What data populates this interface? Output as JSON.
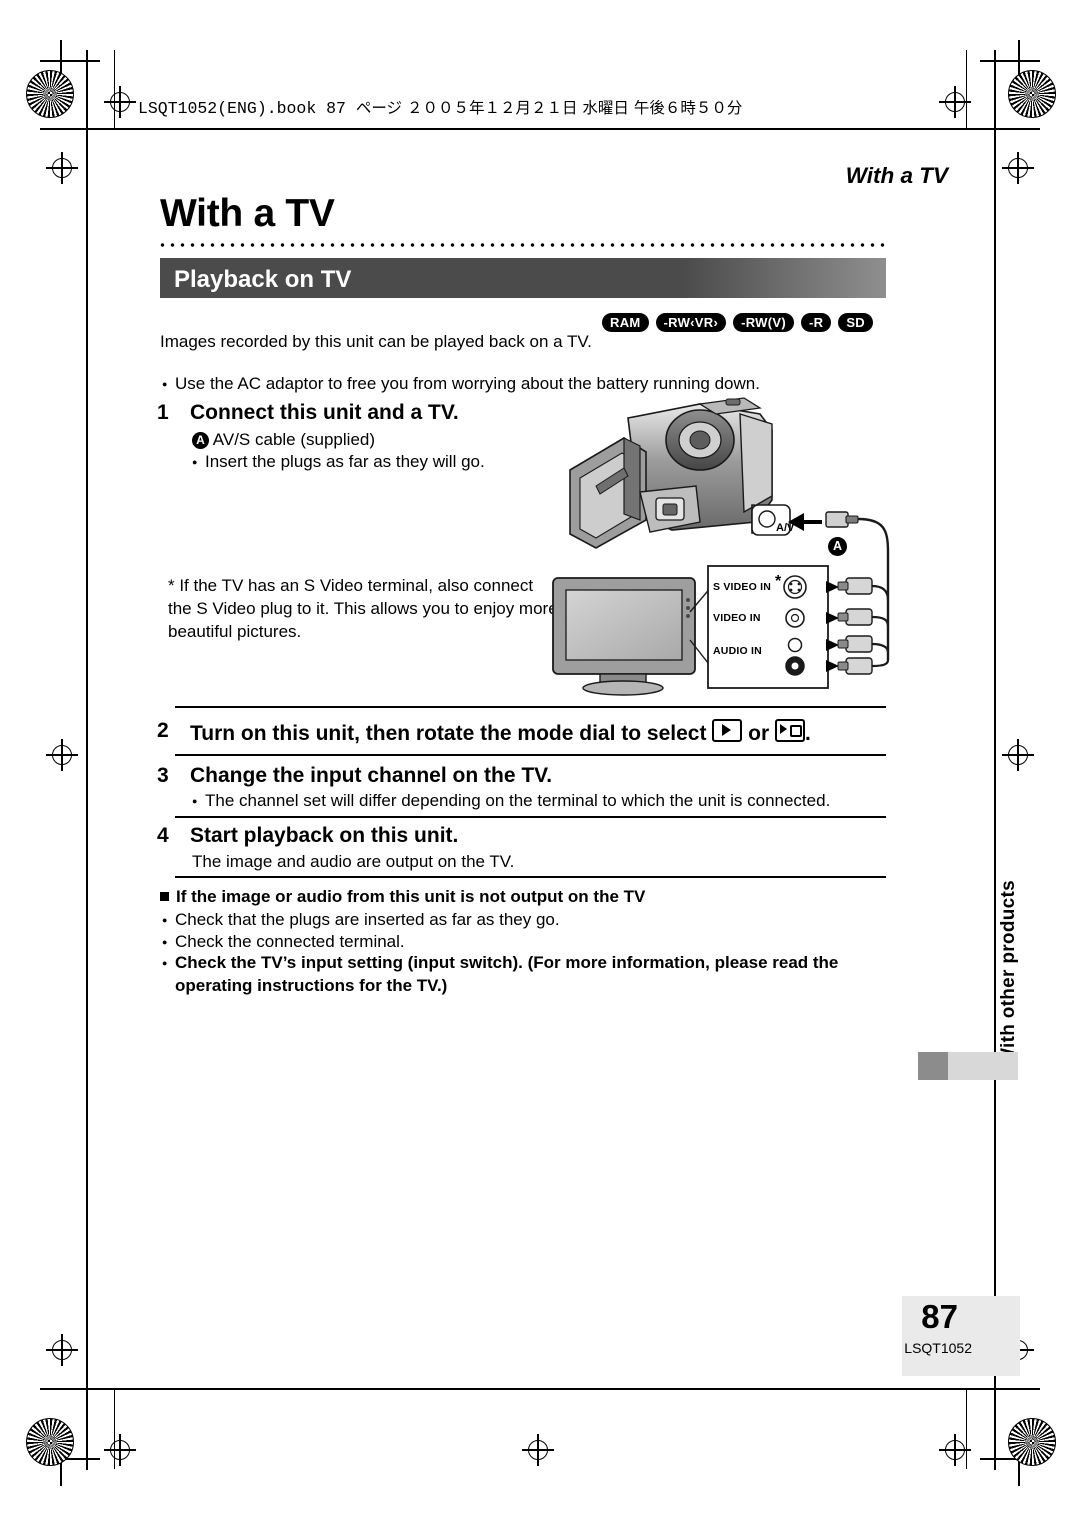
{
  "header": {
    "book_line_ascii": "LSQT1052(ENG).book  87 ",
    "book_line_jp": "ページ ２００５年１２月２１日 水曜日 午後６時５０分",
    "running_head": "With a TV"
  },
  "title": {
    "chapter": "With a TV",
    "section": "Playback on TV"
  },
  "badges": [
    {
      "label": "RAM",
      "shape": "round"
    },
    {
      "label": "-RW‹VR›",
      "shape": "round"
    },
    {
      "label": "-RW(V)",
      "shape": "round"
    },
    {
      "label": "-R",
      "shape": "round"
    },
    {
      "label": "SD",
      "shape": "round"
    }
  ],
  "intro": {
    "line1": "Images recorded by this unit can be played back on a TV.",
    "bullet1": "Use the AC adaptor to free you from worrying about the battery running down."
  },
  "steps": [
    {
      "no": "1",
      "title": "Connect this unit and a TV.",
      "caption_a": "AV/S cable (supplied)",
      "bullet": "Insert the plugs as far as they will go.",
      "note": "* If the TV has an S Video terminal, also connect the S Video plug to it. This allows you to enjoy more beautiful pictures."
    },
    {
      "no": "2",
      "title_prefix": "Turn on this unit, then rotate the mode dial to select",
      "title_middle": "or",
      "title_suffix": "."
    },
    {
      "no": "3",
      "title": "Change the input channel on the TV.",
      "bullet": "The channel set will differ depending on the terminal to which the unit is connected."
    },
    {
      "no": "4",
      "title": "Start playback on this unit.",
      "body": "The image and audio are output on the TV."
    }
  ],
  "troubleshoot": {
    "heading": "If the image or audio from this unit is not output on the TV",
    "bullets": [
      "Check that the plugs are inserted as far as they go.",
      "Check the connected terminal.",
      "Check the TV’s input setting (input switch). (For more information, please read the operating instructions for the TV.)"
    ]
  },
  "illustration": {
    "cable_label": "A/V",
    "callout_a": "A",
    "terminals": [
      "S VIDEO IN",
      "VIDEO IN",
      "AUDIO IN"
    ]
  },
  "sidebar": {
    "tab_text": "With other products"
  },
  "footer": {
    "page_number": "87",
    "doc_code": "LSQT1052"
  }
}
